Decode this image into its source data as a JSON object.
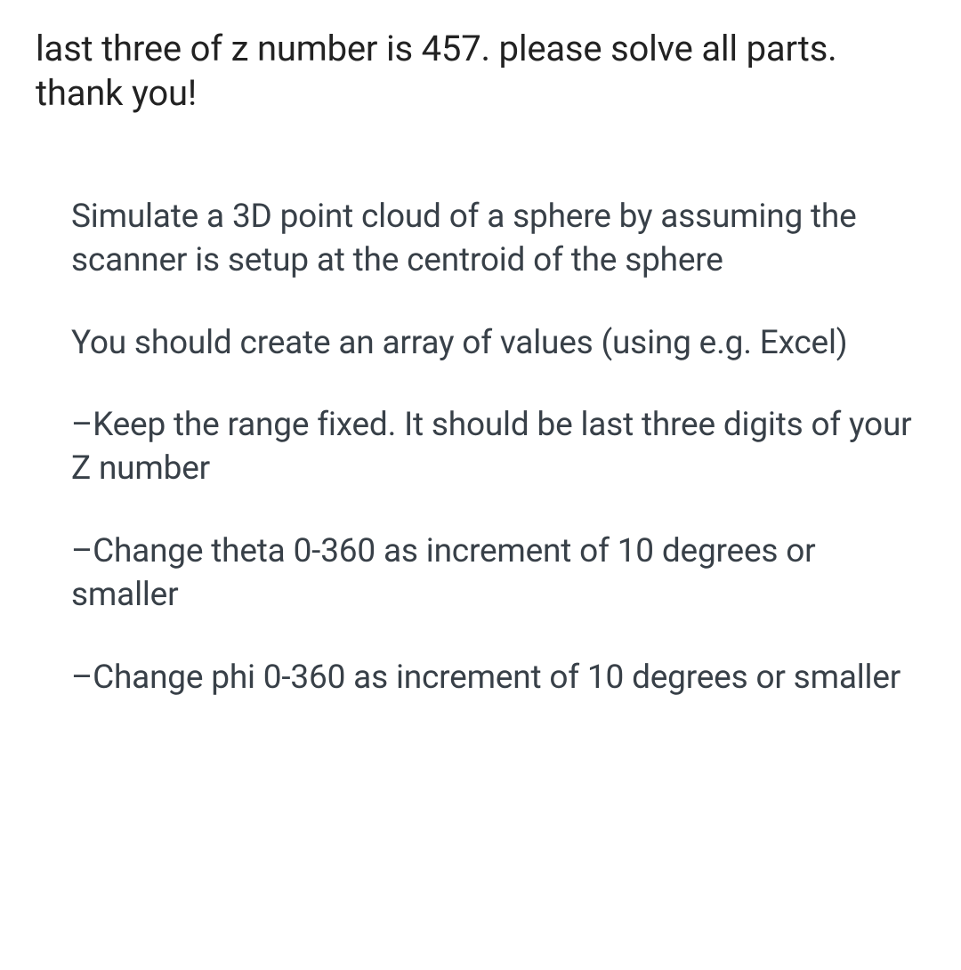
{
  "intro": "last three of z number is 457. please solve all parts. thank you!",
  "content": {
    "p1": "Simulate a 3D point cloud of a sphere by assuming the scanner is setup at the centroid of the sphere",
    "p2": "You should create an array of values (using e.g. Excel)",
    "b1": "–Keep the range fixed. It should be last three digits of your Z number",
    "b2": "–Change theta 0-360 as increment of 10 degrees or smaller",
    "b3": "–Change phi 0-360 as increment of 10 degrees or smaller"
  }
}
